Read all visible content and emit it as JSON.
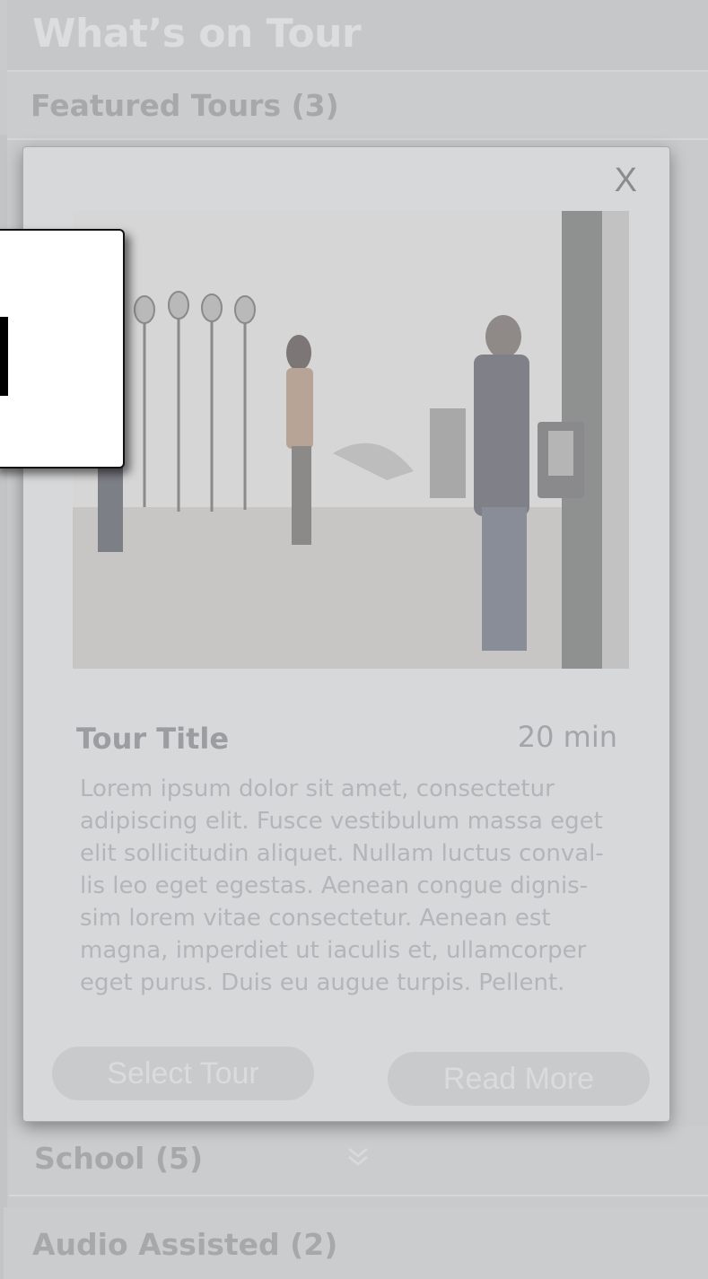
{
  "header": {
    "title": "What’s on Tour"
  },
  "sections": {
    "featured": {
      "label": "Featured Tours (3)"
    },
    "school": {
      "label": "School (5)"
    },
    "audio": {
      "label": "Audio Assisted (2)"
    }
  },
  "modal": {
    "close_label": "X",
    "tour_title": "Tour Title",
    "duration": "20 min",
    "description": "Lorem ipsum dolor sit amet, consectetur adipiscing elit. Fusce vestibulum massa eget elit sollicitudin aliquet. Nullam luctus conval- lis leo eget egestas. Aenean congue dignis- sim lorem vitae consectetur. Aenean est magna, imperdiet ut iaculis et, ullamcorper eget purus. Duis eu augue turpis. Pellent.",
    "select_button": "Select Tour",
    "read_more_button": "Read More"
  },
  "icons": {
    "school_expand": "double-chevron-down-icon"
  }
}
